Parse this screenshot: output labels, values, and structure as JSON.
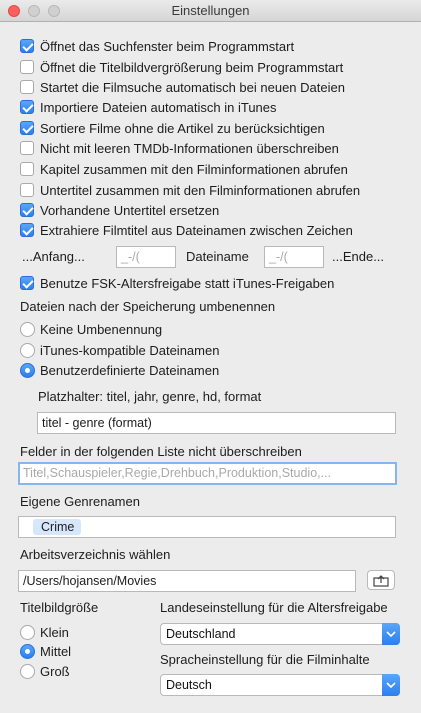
{
  "window": {
    "title": "Einstellungen"
  },
  "checkboxes": [
    {
      "label": "Öffnet das Suchfenster beim Programmstart",
      "checked": true
    },
    {
      "label": "Öffnet die Titelbildvergrößerung beim Programmstart",
      "checked": false
    },
    {
      "label": "Startet die Filmsuche automatisch bei neuen Dateien",
      "checked": false
    },
    {
      "label": "Importiere Dateien automatisch in iTunes",
      "checked": true
    },
    {
      "label": "Sortiere Filme ohne die Artikel zu berücksichtigen",
      "checked": true
    },
    {
      "label": "Nicht mit leeren TMDb-Informationen überschreiben",
      "checked": false
    },
    {
      "label": "Kapitel zusammen mit den Filminformationen abrufen",
      "checked": false
    },
    {
      "label": "Untertitel zusammen mit den Filminformationen abrufen",
      "checked": false
    },
    {
      "label": "Vorhandene Untertitel ersetzen",
      "checked": true
    },
    {
      "label": "Extrahiere Filmtitel aus Dateinamen zwischen Zeichen",
      "checked": true
    }
  ],
  "extract": {
    "start_label": "...Anfang...",
    "start_placeholder": "_-/(",
    "middle_label": "Dateiname",
    "end_placeholder": "_-/(",
    "end_label": "...Ende..."
  },
  "fsk": {
    "label": "Benutze FSK-Altersfreigabe statt iTunes-Freigaben",
    "checked": true
  },
  "rename": {
    "heading": "Dateien nach der Speicherung umbenennen",
    "options": [
      {
        "label": "Keine Umbenennung",
        "selected": false
      },
      {
        "label": "iTunes-kompatible Dateinamen",
        "selected": false
      },
      {
        "label": "Benutzerdefinierte Dateinamen",
        "selected": true
      }
    ],
    "placeholder_hint": "Platzhalter: titel, jahr, genre, hd, format",
    "pattern_value": "titel - genre (format)"
  },
  "no_overwrite": {
    "heading": "Felder in der folgenden Liste nicht überschreiben",
    "placeholder": "Titel,Schauspieler,Regie,Drehbuch,Produktion,Studio,..."
  },
  "genres": {
    "heading": "Eigene Genrenamen",
    "tokens": [
      "Crime"
    ]
  },
  "workdir": {
    "heading": "Arbeitsverzeichnis wählen",
    "path": "/Users/hojansen/Movies",
    "choose_icon": "folder-up-icon"
  },
  "cover_size": {
    "heading": "Titelbildgröße",
    "options": [
      {
        "label": "Klein",
        "selected": false
      },
      {
        "label": "Mittel",
        "selected": true
      },
      {
        "label": "Groß",
        "selected": false
      }
    ]
  },
  "country": {
    "heading": "Landeseinstellung für die Altersfreigabe",
    "value": "Deutschland"
  },
  "language": {
    "heading": "Spracheinstellung für die Filminhalte",
    "value": "Deutsch"
  },
  "colors": {
    "accent": "#2b7ff0",
    "window_bg": "#ececec"
  }
}
